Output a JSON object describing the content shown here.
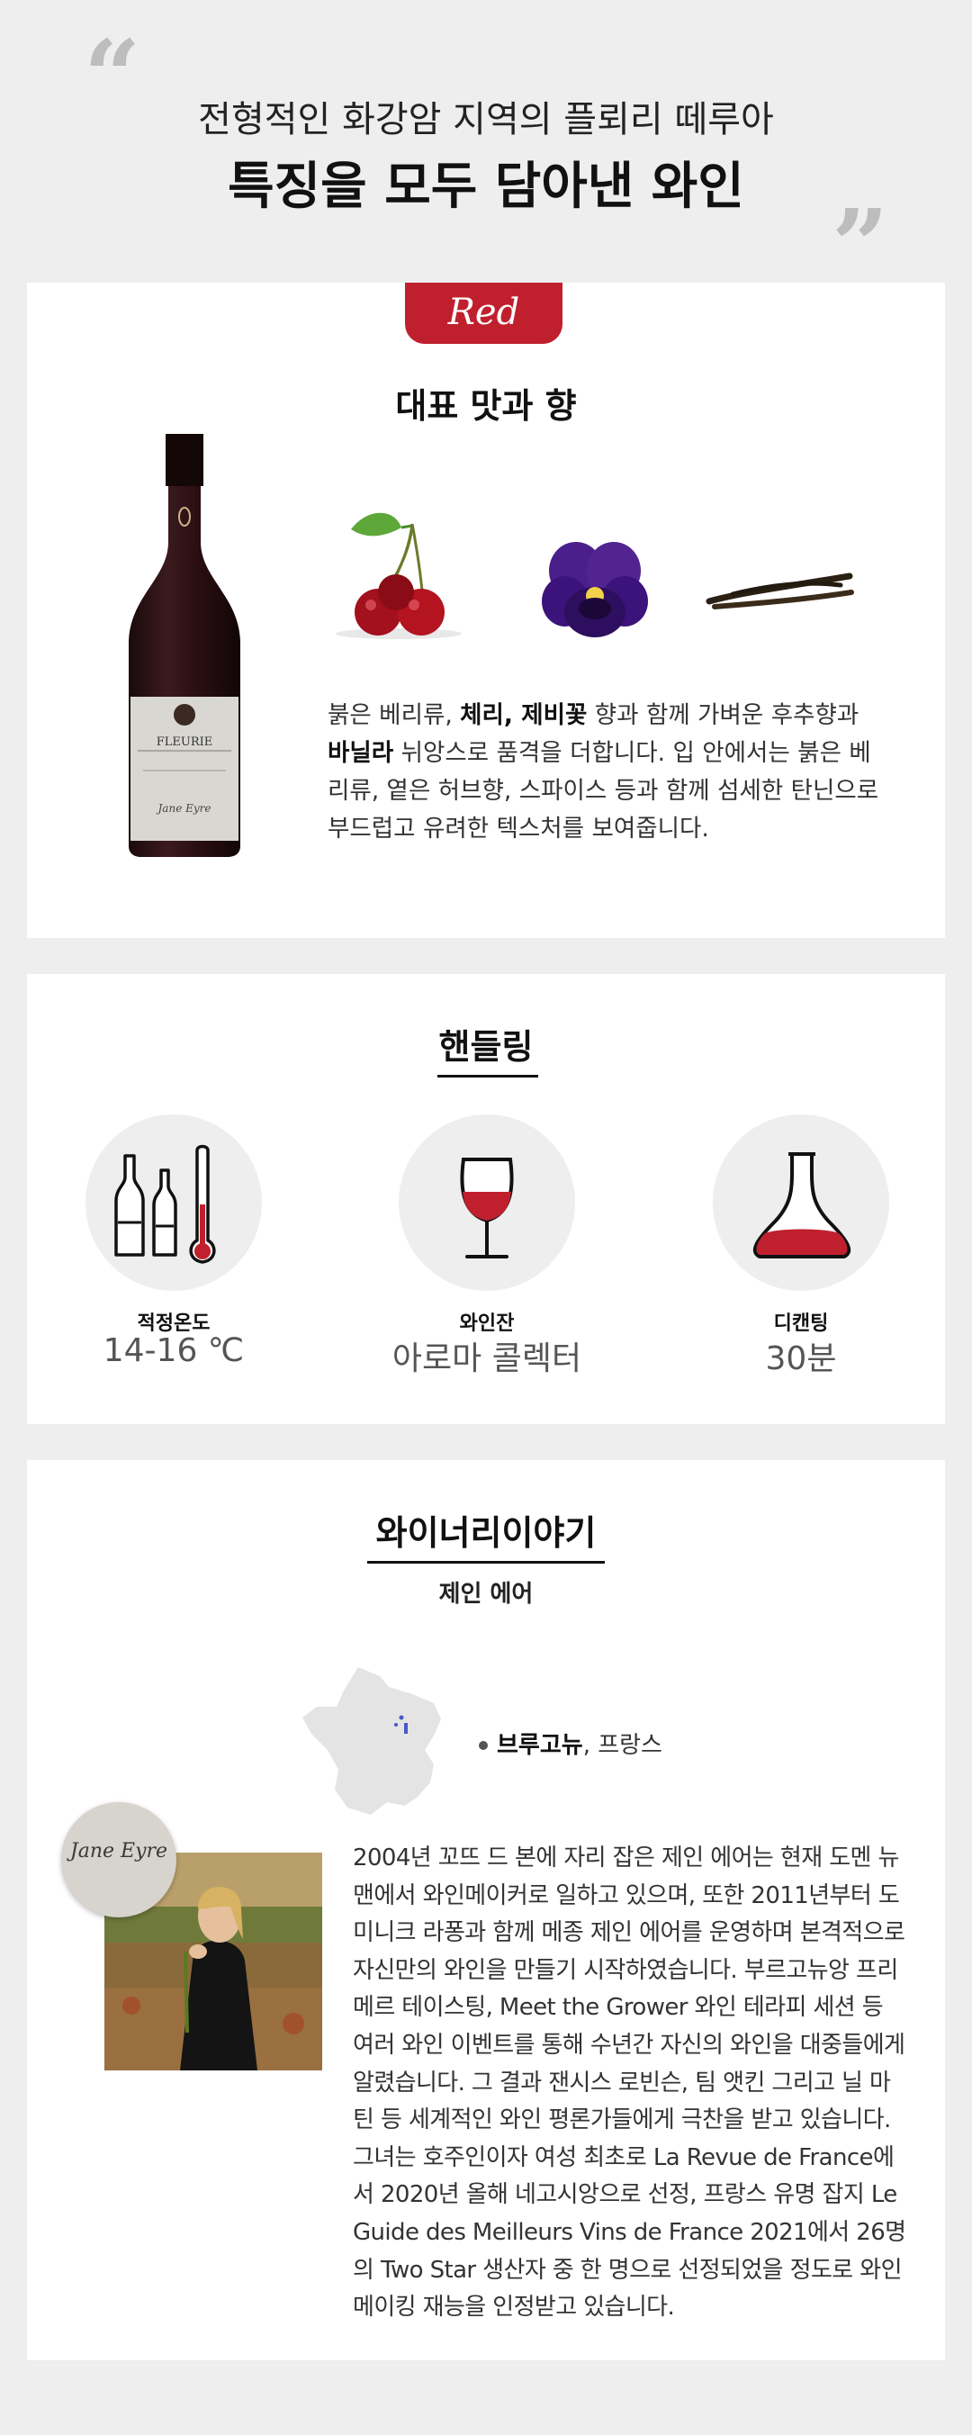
{
  "hero": {
    "line1": "전형적인 화강암 지역의 플뢰리 떼루아",
    "line2": "특징을 모두 담아낸 와인"
  },
  "tasting": {
    "tab_label": "Red",
    "title": "대표 맛과 향",
    "aromas": [
      "cherry",
      "violet-flower",
      "vanilla-pod"
    ],
    "bottle_label": "FLEURIE",
    "bottle_signature": "Jane Eyre",
    "description_parts": [
      {
        "t": "붉은 베리류, ",
        "b": false
      },
      {
        "t": "체리, 제비꽃",
        "b": true
      },
      {
        "t": " 향과 함께 가벼운 후추향과 ",
        "b": false
      },
      {
        "t": "바닐라",
        "b": true
      },
      {
        "t": " 뉘앙스로 품격을 더합니다. 입 안에서는 붉은 베리류, 옅은 허브향, 스파이스 등과 함께 섬세한 탄닌으로 부드럽고 유려한 텍스처를 보여줍니다.",
        "b": false
      }
    ]
  },
  "handling": {
    "title": "핸들링",
    "items": [
      {
        "icon": "temperature-icon",
        "label": "적정온도",
        "value": "14-16 ℃"
      },
      {
        "icon": "wine-glass-icon",
        "label": "와인잔",
        "value": "아로마 콜렉터"
      },
      {
        "icon": "decanter-icon",
        "label": "디캔팅",
        "value": "30분"
      }
    ]
  },
  "winery": {
    "title": "와이너리이야기",
    "name": "제인 에어",
    "region_bold": "브루고뉴",
    "region_rest": ", 프랑스",
    "badge_text": "Jane Eyre",
    "story": "2004년  꼬뜨 드 본에 자리 잡은 제인 에어는 현재 도멘 뉴맨에서 와인메이커로 일하고 있으며, 또한 2011년부터 도미니크 라퐁과 함께 메종 제인 에어를 운영하며 본격적으로 자신만의 와인을 만들기 시작하였습니다. 부르고뉴앙 프리메르 테이스팅,  Meet the Grower 와인 테라피 세션 등 여러 와인 이벤트를 통해 수년간 자신의 와인을 대중들에게 알렸습니다. 그 결과 잰시스 로빈슨, 팀 앳킨 그리고 닐 마틴 등 세계적인 와인 평론가들에게 극찬을 받고 있습니다. 그녀는 호주인이자 여성 최초로 La Revue de France에서 2020년 올해 네고시앙으로 선정, 프랑스 유명 잡지 Le Guide des Meilleurs Vins de France 2021에서 26명의 Two Star 생산자 중 한 명으로 선정되었을 정도로 와인메이킹 재능을 인정받고 있습니다."
  },
  "colors": {
    "accent": "#c0202e",
    "background": "#eeeeee",
    "card": "#ffffff"
  }
}
